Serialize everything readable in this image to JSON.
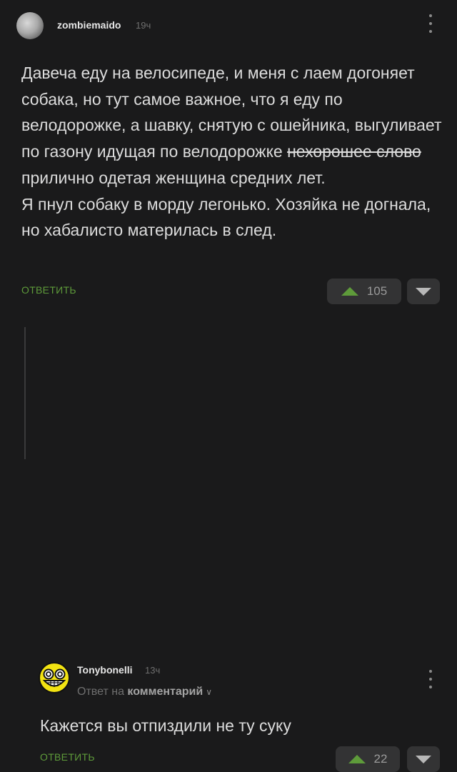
{
  "comments": [
    {
      "username": "zombiemaido",
      "timestamp": "19ч",
      "text_before_strike": "Давеча еду на велосипеде, и меня с лаем догоняет собака, но тут самое важное, что я еду по велодорожке, а шавку, снятую с ошейника, выгуливает по газону идущая по велодорожке",
      "strike_text": "нехорошее слово",
      "text_after_strike": "прилично одетая женщина средних лет.",
      "text_second_line": "Я пнул собаку в морду легонько. Хозяйка не догнала, но хабалисто материлась в след.",
      "reply_label": "ОТВЕТИТЬ",
      "upvotes": "105"
    },
    {
      "username": "Tonybonelli",
      "timestamp": "13ч",
      "reply_to_prefix": "Ответ на",
      "reply_to_target": "комментарий",
      "text": "Кажется вы отпиздили не ту суку",
      "reply_label": "ОТВЕТИТЬ",
      "upvotes": "22"
    }
  ],
  "icons": {
    "avatar1": "moon-avatar",
    "avatar2": "smiley-avatar",
    "menu": "kebab-menu-icon",
    "upvote": "upvote-triangle-icon",
    "downvote": "downvote-triangle-icon",
    "chevron": "chevron-down-icon"
  },
  "colors": {
    "background": "#1a1a1b",
    "text": "#dcdcdc",
    "accent_green": "#5e9b3a",
    "muted": "#6f6f6f",
    "button_bg": "#333334"
  }
}
